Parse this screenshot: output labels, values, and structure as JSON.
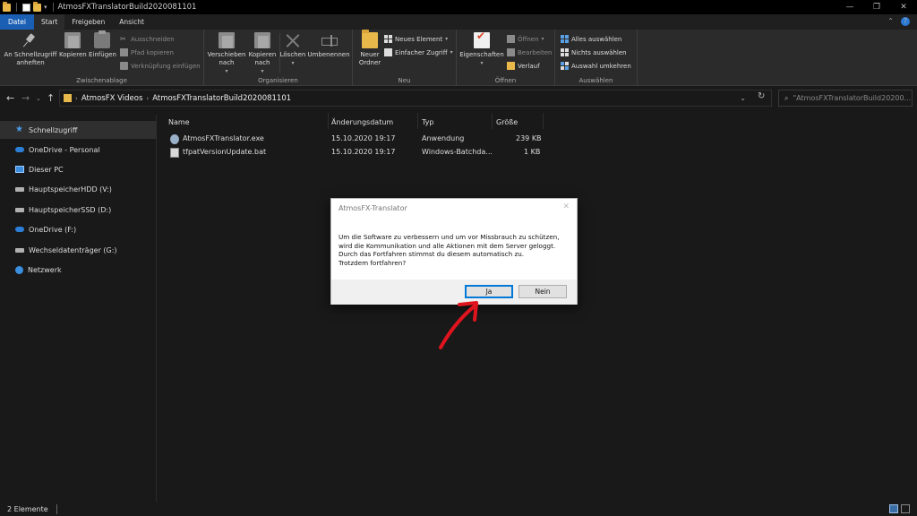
{
  "window": {
    "title": "AtmosFXTranslatorBuild2020081101"
  },
  "tabs": [
    {
      "label": "Datei"
    },
    {
      "label": "Start"
    },
    {
      "label": "Freigeben"
    },
    {
      "label": "Ansicht"
    }
  ],
  "ribbon": {
    "clipboard": {
      "label": "Zwischenablage",
      "pin": "An Schnellzugriff\nanheften",
      "copy": "Kopieren",
      "paste": "Einfügen",
      "cut": "Ausschneiden",
      "copy_path": "Pfad kopieren",
      "paste_shortcut": "Verknüpfung einfügen"
    },
    "organize": {
      "label": "Organisieren",
      "move": "Verschieben\nnach",
      "copy_to": "Kopieren\nnach",
      "delete": "Löschen",
      "rename": "Umbenennen"
    },
    "new": {
      "label": "Neu",
      "new_folder": "Neuer\nOrdner",
      "new_item": "Neues Element",
      "easy_access": "Einfacher Zugriff"
    },
    "open": {
      "label": "Öffnen",
      "properties": "Eigenschaften",
      "open": "Öffnen",
      "edit": "Bearbeiten",
      "history": "Verlauf"
    },
    "select": {
      "label": "Auswählen",
      "select_all": "Alles auswählen",
      "select_none": "Nichts auswählen",
      "invert": "Auswahl umkehren"
    }
  },
  "address": {
    "crumbs": [
      "AtmosFX Videos",
      "AtmosFXTranslatorBuild2020081101"
    ],
    "search_placeholder": "\"AtmosFXTranslatorBuild20200..."
  },
  "sidebar": {
    "items": [
      {
        "label": "Schnellzugriff",
        "icon": "star-icon"
      },
      {
        "label": "OneDrive - Personal",
        "icon": "cloud-icon"
      },
      {
        "label": "Dieser PC",
        "icon": "pc-icon"
      },
      {
        "label": "HauptspeicherHDD (V:)",
        "icon": "drive-icon"
      },
      {
        "label": "HauptspeicherSSD (D:)",
        "icon": "drive-icon"
      },
      {
        "label": "OneDrive (F:)",
        "icon": "cloud-icon"
      },
      {
        "label": "Wechseldatenträger (G:)",
        "icon": "drive-icon"
      },
      {
        "label": "Netzwerk",
        "icon": "network-icon"
      }
    ]
  },
  "files": {
    "columns": [
      "Name",
      "Änderungsdatum",
      "Typ",
      "Größe"
    ],
    "rows": [
      {
        "name": "AtmosFXTranslator.exe",
        "date": "15.10.2020 19:17",
        "type": "Anwendung",
        "size": "239 KB"
      },
      {
        "name": "tfpatVersionUpdate.bat",
        "date": "15.10.2020 19:17",
        "type": "Windows-Batchda...",
        "size": "1 KB"
      }
    ]
  },
  "status": {
    "count": "2 Elemente"
  },
  "dialog": {
    "title": "AtmosFX-Translator",
    "lines": [
      "Um die Software zu verbessern und um vor Missbrauch zu schützen,",
      "wird die Kommunikation und alle Aktionen mit dem Server geloggt.",
      "Durch das Fortfahren stimmst du diesem automatisch zu.",
      "Trotzdem fortfahren?"
    ],
    "yes": "Ja",
    "no": "Nein"
  },
  "colors": {
    "accent": "#1a5fb4",
    "annotation_arrow": "#e0141e"
  }
}
